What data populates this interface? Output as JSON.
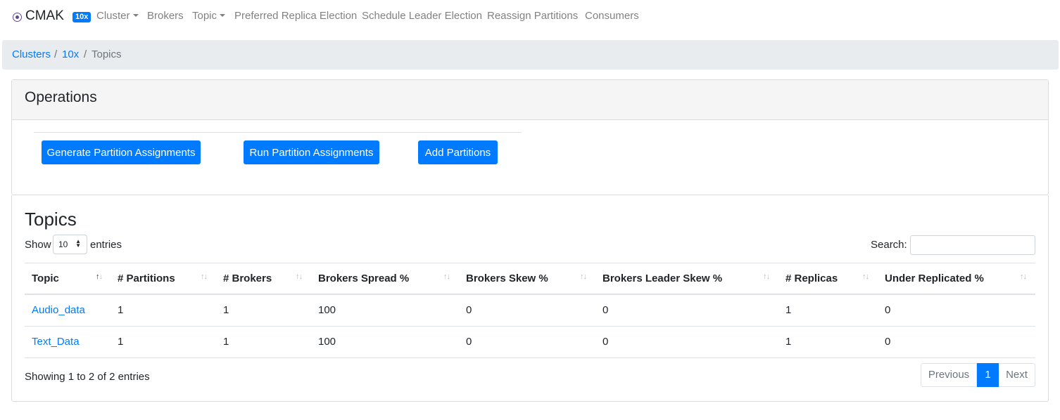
{
  "navbar": {
    "brand": "CMAK",
    "badge": "10x",
    "items": [
      {
        "label": "Cluster",
        "dropdown": true
      },
      {
        "label": "Brokers",
        "dropdown": false
      },
      {
        "label": "Topic",
        "dropdown": true
      },
      {
        "label": "Preferred Replica Election",
        "dropdown": false
      },
      {
        "label": "Schedule Leader Election",
        "dropdown": false
      },
      {
        "label": "Reassign Partitions",
        "dropdown": false
      },
      {
        "label": "Consumers",
        "dropdown": false
      }
    ]
  },
  "breadcrumb": {
    "items": [
      "Clusters",
      "10x",
      "Topics"
    ],
    "separator": "/"
  },
  "operations": {
    "title": "Operations",
    "buttons": [
      "Generate Partition Assignments",
      "Run Partition Assignments",
      "Add Partitions"
    ]
  },
  "topics": {
    "title": "Topics",
    "show_label": "Show",
    "page_size": "10",
    "entries_label": "entries",
    "search_label": "Search:",
    "search_value": "",
    "columns": [
      "Topic",
      "# Partitions",
      "# Brokers",
      "Brokers Spread %",
      "Brokers Skew %",
      "Brokers Leader Skew %",
      "# Replicas",
      "Under Replicated %"
    ],
    "rows": [
      [
        "Audio_data",
        "1",
        "1",
        "100",
        "0",
        "0",
        "1",
        "0"
      ],
      [
        "Text_Data",
        "1",
        "1",
        "100",
        "0",
        "0",
        "1",
        "0"
      ]
    ],
    "info": "Showing 1 to 2 of 2 entries",
    "pagination": {
      "previous": "Previous",
      "current": "1",
      "next": "Next"
    }
  },
  "colors": {
    "primary": "#007bff",
    "breadcrumb_bg": "#e9ecef",
    "card_header_bg": "#f5f5f5"
  },
  "icons": {
    "brand": "radio-circle-icon",
    "sort": "sort-arrows-icon"
  }
}
